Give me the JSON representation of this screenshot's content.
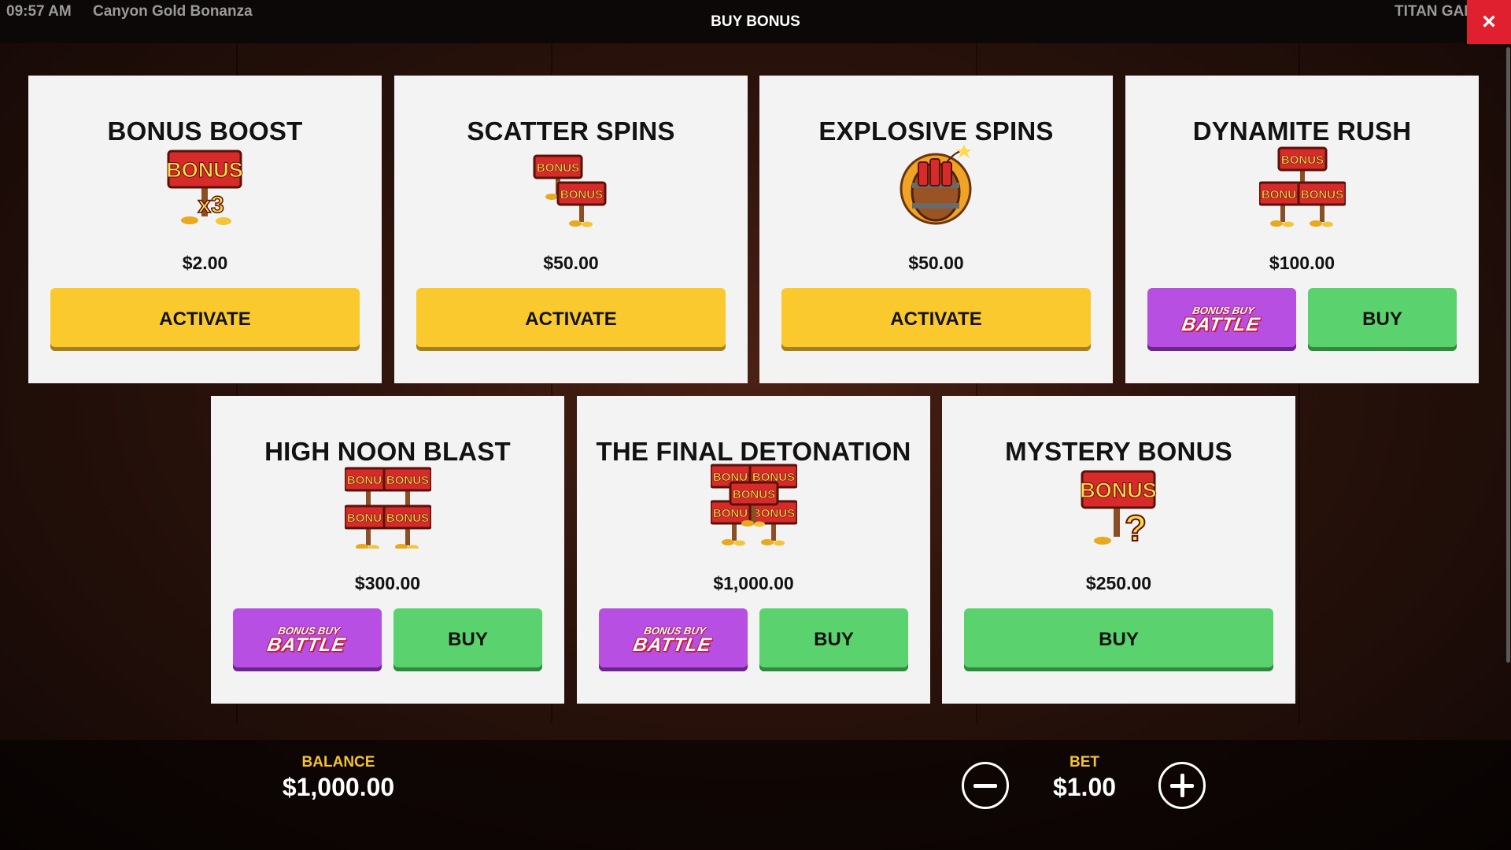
{
  "status": {
    "time": "09:57 AM",
    "game_title": "Canyon Gold Bonanza",
    "brand": "TITAN GAMING"
  },
  "modal": {
    "title": "BUY BONUS",
    "close_icon": "×"
  },
  "battle_logo": {
    "top": "BONUS BUY",
    "main": "BATTLE"
  },
  "cards": [
    {
      "title": "BONUS BOOST",
      "price": "$2.00",
      "icon": "bonus-x3-sign-icon",
      "button": "ACTIVATE"
    },
    {
      "title": "SCATTER SPINS",
      "price": "$50.00",
      "icon": "two-bonus-signs-icon",
      "button": "ACTIVATE"
    },
    {
      "title": "EXPLOSIVE SPINS",
      "price": "$50.00",
      "icon": "dynamite-barrel-icon",
      "button": "ACTIVATE"
    },
    {
      "title": "DYNAMITE RUSH",
      "price": "$100.00",
      "icon": "three-bonus-signs-icon",
      "button": "BUY"
    },
    {
      "title": "HIGH NOON BLAST",
      "price": "$300.00",
      "icon": "four-bonus-signs-icon",
      "button": "BUY"
    },
    {
      "title": "THE FINAL DETONATION",
      "price": "$1,000.00",
      "icon": "five-bonus-signs-icon",
      "button": "BUY"
    },
    {
      "title": "MYSTERY BONUS",
      "price": "$250.00",
      "icon": "bonus-question-sign-icon",
      "button": "BUY"
    }
  ],
  "footer": {
    "balance_label": "BALANCE",
    "balance_value": "$1,000.00",
    "bet_label": "BET",
    "bet_value": "$1.00"
  },
  "colors": {
    "activate": "#f9c92e",
    "buy": "#5ad26d",
    "battle": "#b64fe2",
    "close": "#e1202f",
    "label_gold": "#f5c32c"
  }
}
